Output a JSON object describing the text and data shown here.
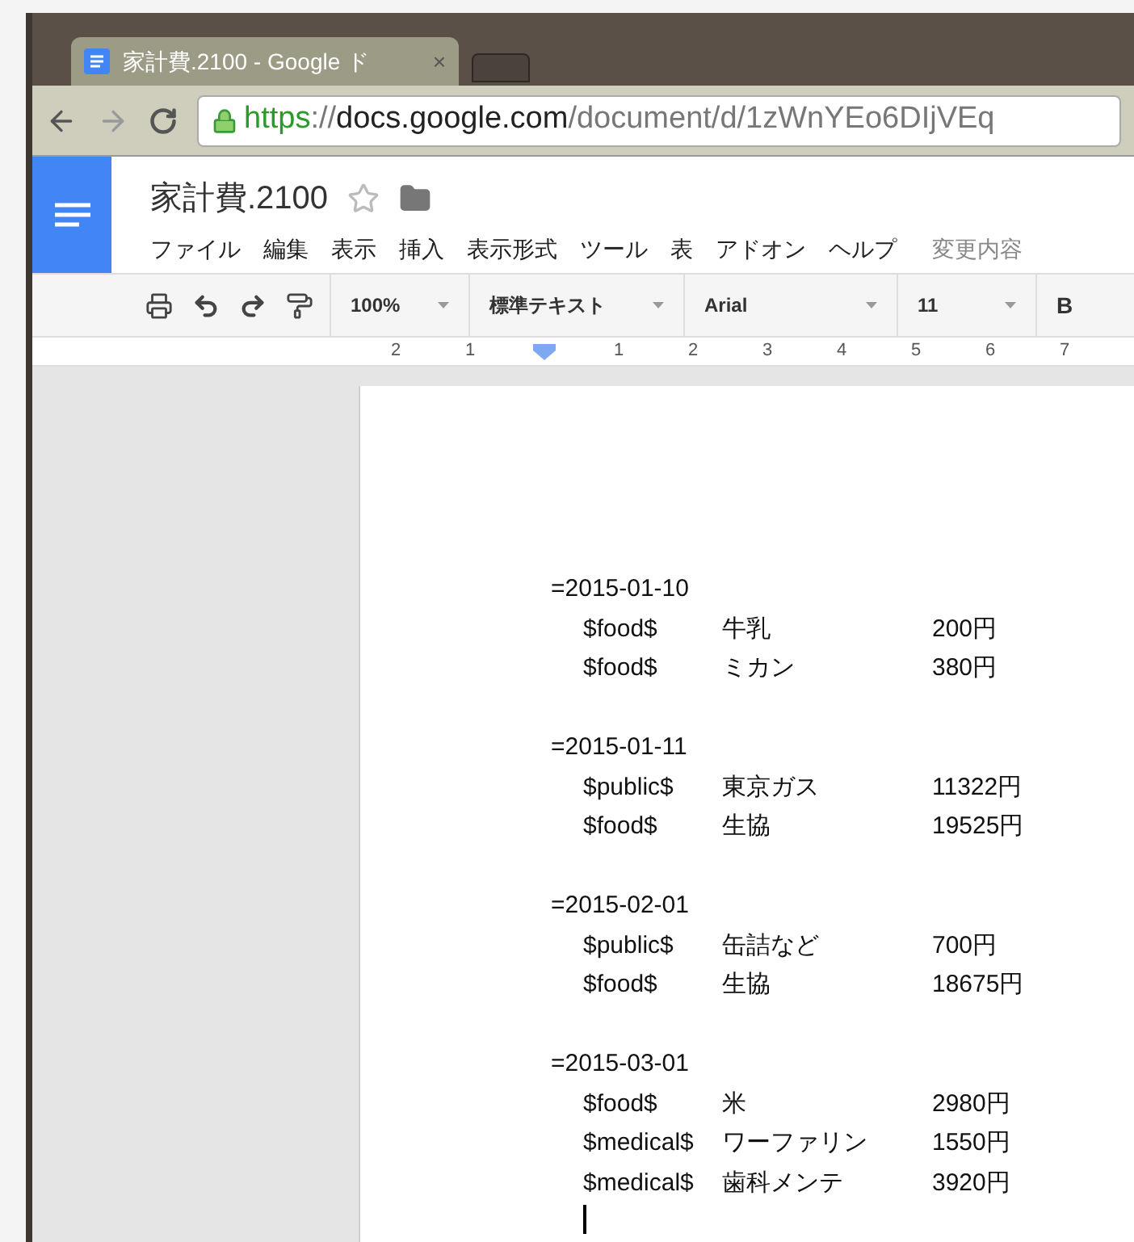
{
  "browser": {
    "tab": {
      "title": "家計費.2100 - Google ド",
      "close": "×"
    },
    "address": {
      "parts": [
        {
          "kind": "scheme",
          "text": "https"
        },
        {
          "kind": "dim",
          "text": "://"
        },
        {
          "kind": "host",
          "text": "docs.google.com"
        },
        {
          "kind": "dim",
          "text": "/document/d/1zWnYEo6DIjVEq"
        }
      ]
    }
  },
  "docs": {
    "title": "家計費.2100",
    "menu": [
      "ファイル",
      "編集",
      "表示",
      "挿入",
      "表示形式",
      "ツール",
      "表",
      "アドオン",
      "ヘルプ"
    ],
    "last_edit": "変更内容",
    "toolbar": {
      "zoom": "100%",
      "style": "標準テキスト",
      "font": "Arial",
      "size": "11",
      "bold": "B"
    },
    "ruler": [
      {
        "kind": "number",
        "label": "2"
      },
      {
        "kind": "number",
        "label": "1"
      },
      {
        "kind": "indent_marker"
      },
      {
        "kind": "number",
        "label": "1"
      },
      {
        "kind": "number",
        "label": "2"
      },
      {
        "kind": "number",
        "label": "3"
      },
      {
        "kind": "number",
        "label": "4"
      },
      {
        "kind": "number",
        "label": "5"
      },
      {
        "kind": "number",
        "label": "6"
      },
      {
        "kind": "number",
        "label": "7"
      }
    ]
  },
  "document": [
    {
      "date": "=2015-01-10",
      "entries": [
        {
          "category": "$food$",
          "item": "牛乳",
          "amount": "200円"
        },
        {
          "category": "$food$",
          "item": "ミカン",
          "amount": "380円"
        }
      ]
    },
    {
      "date": "=2015-01-11",
      "entries": [
        {
          "category": "$public$",
          "item": "東京ガス",
          "amount": "11322円"
        },
        {
          "category": "$food$",
          "item": "生協",
          "amount": "19525円"
        }
      ]
    },
    {
      "date": "=2015-02-01",
      "entries": [
        {
          "category": "$public$",
          "item": "缶詰など",
          "amount": "700円"
        },
        {
          "category": "$food$",
          "item": "生協",
          "amount": "18675円"
        }
      ]
    },
    {
      "date": "=2015-03-01",
      "entries": [
        {
          "category": "$food$",
          "item": "米",
          "amount": "2980円"
        },
        {
          "category": "$medical$",
          "item": "ワーファリン",
          "amount": "1550円"
        },
        {
          "category": "$medical$",
          "item": "歯科メンテ",
          "amount": "3920円"
        }
      ]
    }
  ]
}
